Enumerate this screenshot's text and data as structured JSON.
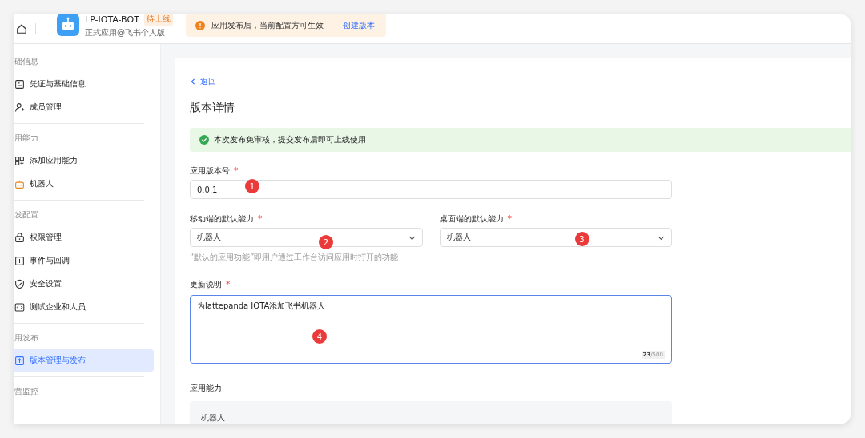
{
  "header": {
    "app_name": "LP-IOTA-BOT",
    "status_tag": "待上线",
    "subtitle": "正式应用@飞书个人版",
    "notice": {
      "text": "应用发布后，当前配置方可生效",
      "link": "创建版本"
    }
  },
  "sidebar": {
    "groups": [
      {
        "title": "础信息",
        "items": [
          {
            "label": "凭证与基础信息",
            "kind": "doc",
            "selected": false
          },
          {
            "label": "成员管理",
            "kind": "user",
            "selected": false
          }
        ]
      },
      {
        "title": "用能力",
        "items": [
          {
            "label": "添加应用能力",
            "kind": "grid",
            "selected": false
          },
          {
            "label": "机器人",
            "kind": "robot",
            "selected": false
          }
        ]
      },
      {
        "title": "发配置",
        "items": [
          {
            "label": "权限管理",
            "kind": "lock",
            "selected": false
          },
          {
            "label": "事件与回调",
            "kind": "event",
            "selected": false
          },
          {
            "label": "安全设置",
            "kind": "shield",
            "selected": false
          },
          {
            "label": "测试企业和人员",
            "kind": "code",
            "selected": false
          }
        ]
      },
      {
        "title": "用发布",
        "items": [
          {
            "label": "版本管理与发布",
            "kind": "upload",
            "selected": true
          }
        ]
      },
      {
        "title": "营监控"
      }
    ]
  },
  "content": {
    "back_link": "返回",
    "title": "版本详情",
    "alert": "本次发布免审核，提交发布后即可上线使用",
    "version": {
      "label": "应用版本号",
      "required_mark": "*",
      "value": "0.0.1",
      "marker": "1"
    },
    "mobile_default": {
      "label": "移动端的默认能力",
      "required_mark": "*",
      "value": "机器人",
      "marker": "2"
    },
    "desktop_default": {
      "label": "桌面端的默认能力",
      "required_mark": "*",
      "value": "机器人",
      "marker": "3"
    },
    "hint": "“默认的应用功能”即用户通过工作台访问应用时打开的功能",
    "notes": {
      "label": "更新说明",
      "required_mark": "*",
      "value": "为lattepanda IOTA添加飞书机器人",
      "count": "23",
      "max": "/500",
      "marker": "4"
    },
    "capabilities": {
      "label": "应用能力",
      "items": [
        "机器人"
      ]
    }
  }
}
